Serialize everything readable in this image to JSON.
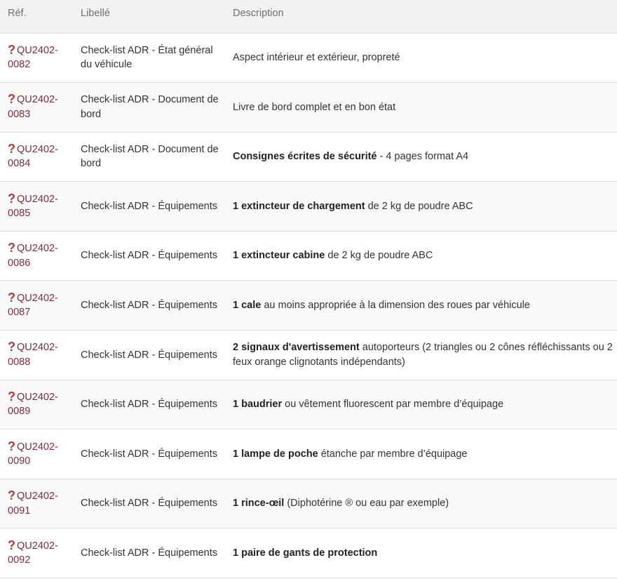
{
  "table": {
    "headers": {
      "ref": "Réf.",
      "libelle": "Libellé",
      "description": "Description"
    },
    "rows": [
      {
        "ref_prefix": "QU2402-",
        "ref_number": "0082",
        "libelle": "Check-list ADR - État général du véhicule",
        "desc_bold": "",
        "desc_rest": "Aspect intérieur et extérieur, propreté"
      },
      {
        "ref_prefix": "QU2402-",
        "ref_number": "0083",
        "libelle": "Check-list ADR - Document de bord",
        "desc_bold": "",
        "desc_rest": "Livre de bord complet et en bon état"
      },
      {
        "ref_prefix": "QU2402-",
        "ref_number": "0084",
        "libelle": "Check-list ADR - Document de bord",
        "desc_bold": "Consignes écrites de sécurité",
        "desc_rest": " - 4 pages format A4"
      },
      {
        "ref_prefix": "QU2402-",
        "ref_number": "0085",
        "libelle": "Check-list ADR - Équipements",
        "desc_bold": "1 extincteur de chargement",
        "desc_rest": " de 2 kg de poudre ABC"
      },
      {
        "ref_prefix": "QU2402-",
        "ref_number": "0086",
        "libelle": "Check-list ADR - Équipements",
        "desc_bold": "1 extincteur cabine",
        "desc_rest": " de 2 kg de poudre ABC"
      },
      {
        "ref_prefix": "QU2402-",
        "ref_number": "0087",
        "libelle": "Check-list ADR - Équipements",
        "desc_bold": "1 cale",
        "desc_rest": " au moins appropriée à la dimension des roues par véhicule"
      },
      {
        "ref_prefix": "QU2402-",
        "ref_number": "0088",
        "libelle": "Check-list ADR - Équipements",
        "desc_bold": "2 signaux d'avertissement",
        "desc_rest": " autoporteurs (2 triangles ou 2 cônes réfléchissants ou 2 feux orange clignotants indépendants)"
      },
      {
        "ref_prefix": "QU2402-",
        "ref_number": "0089",
        "libelle": "Check-list ADR - Équipements",
        "desc_bold": "1 baudrier",
        "desc_rest": " ou vêtement fluorescent par membre d’équipage"
      },
      {
        "ref_prefix": "QU2402-",
        "ref_number": "0090",
        "libelle": "Check-list ADR - Équipements",
        "desc_bold": "1 lampe de poche",
        "desc_rest": " étanche par membre d’équipage"
      },
      {
        "ref_prefix": "QU2402-",
        "ref_number": "0091",
        "libelle": "Check-list ADR - Équipements",
        "desc_bold": "1 rince-œil",
        "desc_rest": " (Diphotérine ® ou eau par exemple)"
      },
      {
        "ref_prefix": "QU2402-",
        "ref_number": "0092",
        "libelle": "Check-list ADR - Équipements",
        "desc_bold": "1 paire de gants de protection",
        "desc_rest": ""
      }
    ]
  },
  "icons": {
    "status": "question-mark-icon"
  },
  "colors": {
    "link": "#7c2b3e",
    "status_icon": "#b03a3a",
    "header_bg": "#f2f2f2"
  }
}
